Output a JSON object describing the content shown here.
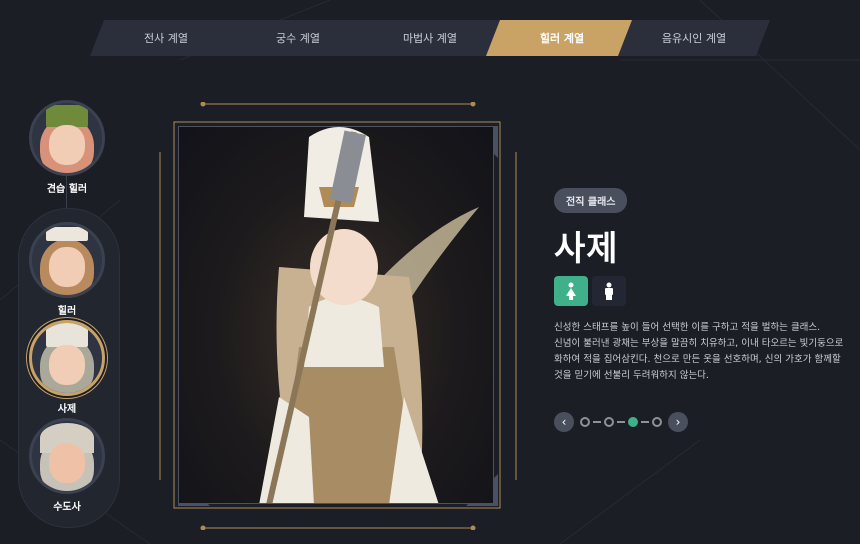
{
  "tabs": [
    {
      "label": "전사 계열",
      "active": false
    },
    {
      "label": "궁수 계열",
      "active": false
    },
    {
      "label": "마법사 계열",
      "active": false
    },
    {
      "label": "힐러 계열",
      "active": true
    },
    {
      "label": "음유시인 계열",
      "active": false
    }
  ],
  "characters": [
    {
      "label": "견습 힐러",
      "selected": false
    },
    {
      "label": "힐러",
      "selected": false
    },
    {
      "label": "사제",
      "selected": true
    },
    {
      "label": "수도사",
      "selected": false
    }
  ],
  "info": {
    "badge": "전직 클래스",
    "title": "사제",
    "gender_female_icon": "female-icon",
    "gender_male_icon": "male-icon",
    "description_lines": [
      "신성한 스태프를 높이 들어 선택한 이를 구하고 적을 벌하는 클래스.",
      "신념이 불러낸 광채는 부상을 말끔히 치유하고, 이내 타오르는 빛기둥으로",
      "화하여 적을 집어삼킨다. 천으로 만든 옷을 선호하며, 신의 가호가 함께할",
      "것을 믿기에 선불리 두려워하지 않는다."
    ]
  },
  "pager": {
    "prev_icon": "chevron-left-icon",
    "next_icon": "chevron-right-icon",
    "total": 4,
    "current": 3
  },
  "colors": {
    "accent_gold": "#c9a266",
    "accent_green": "#3fb089",
    "background": "#1b1e25"
  }
}
